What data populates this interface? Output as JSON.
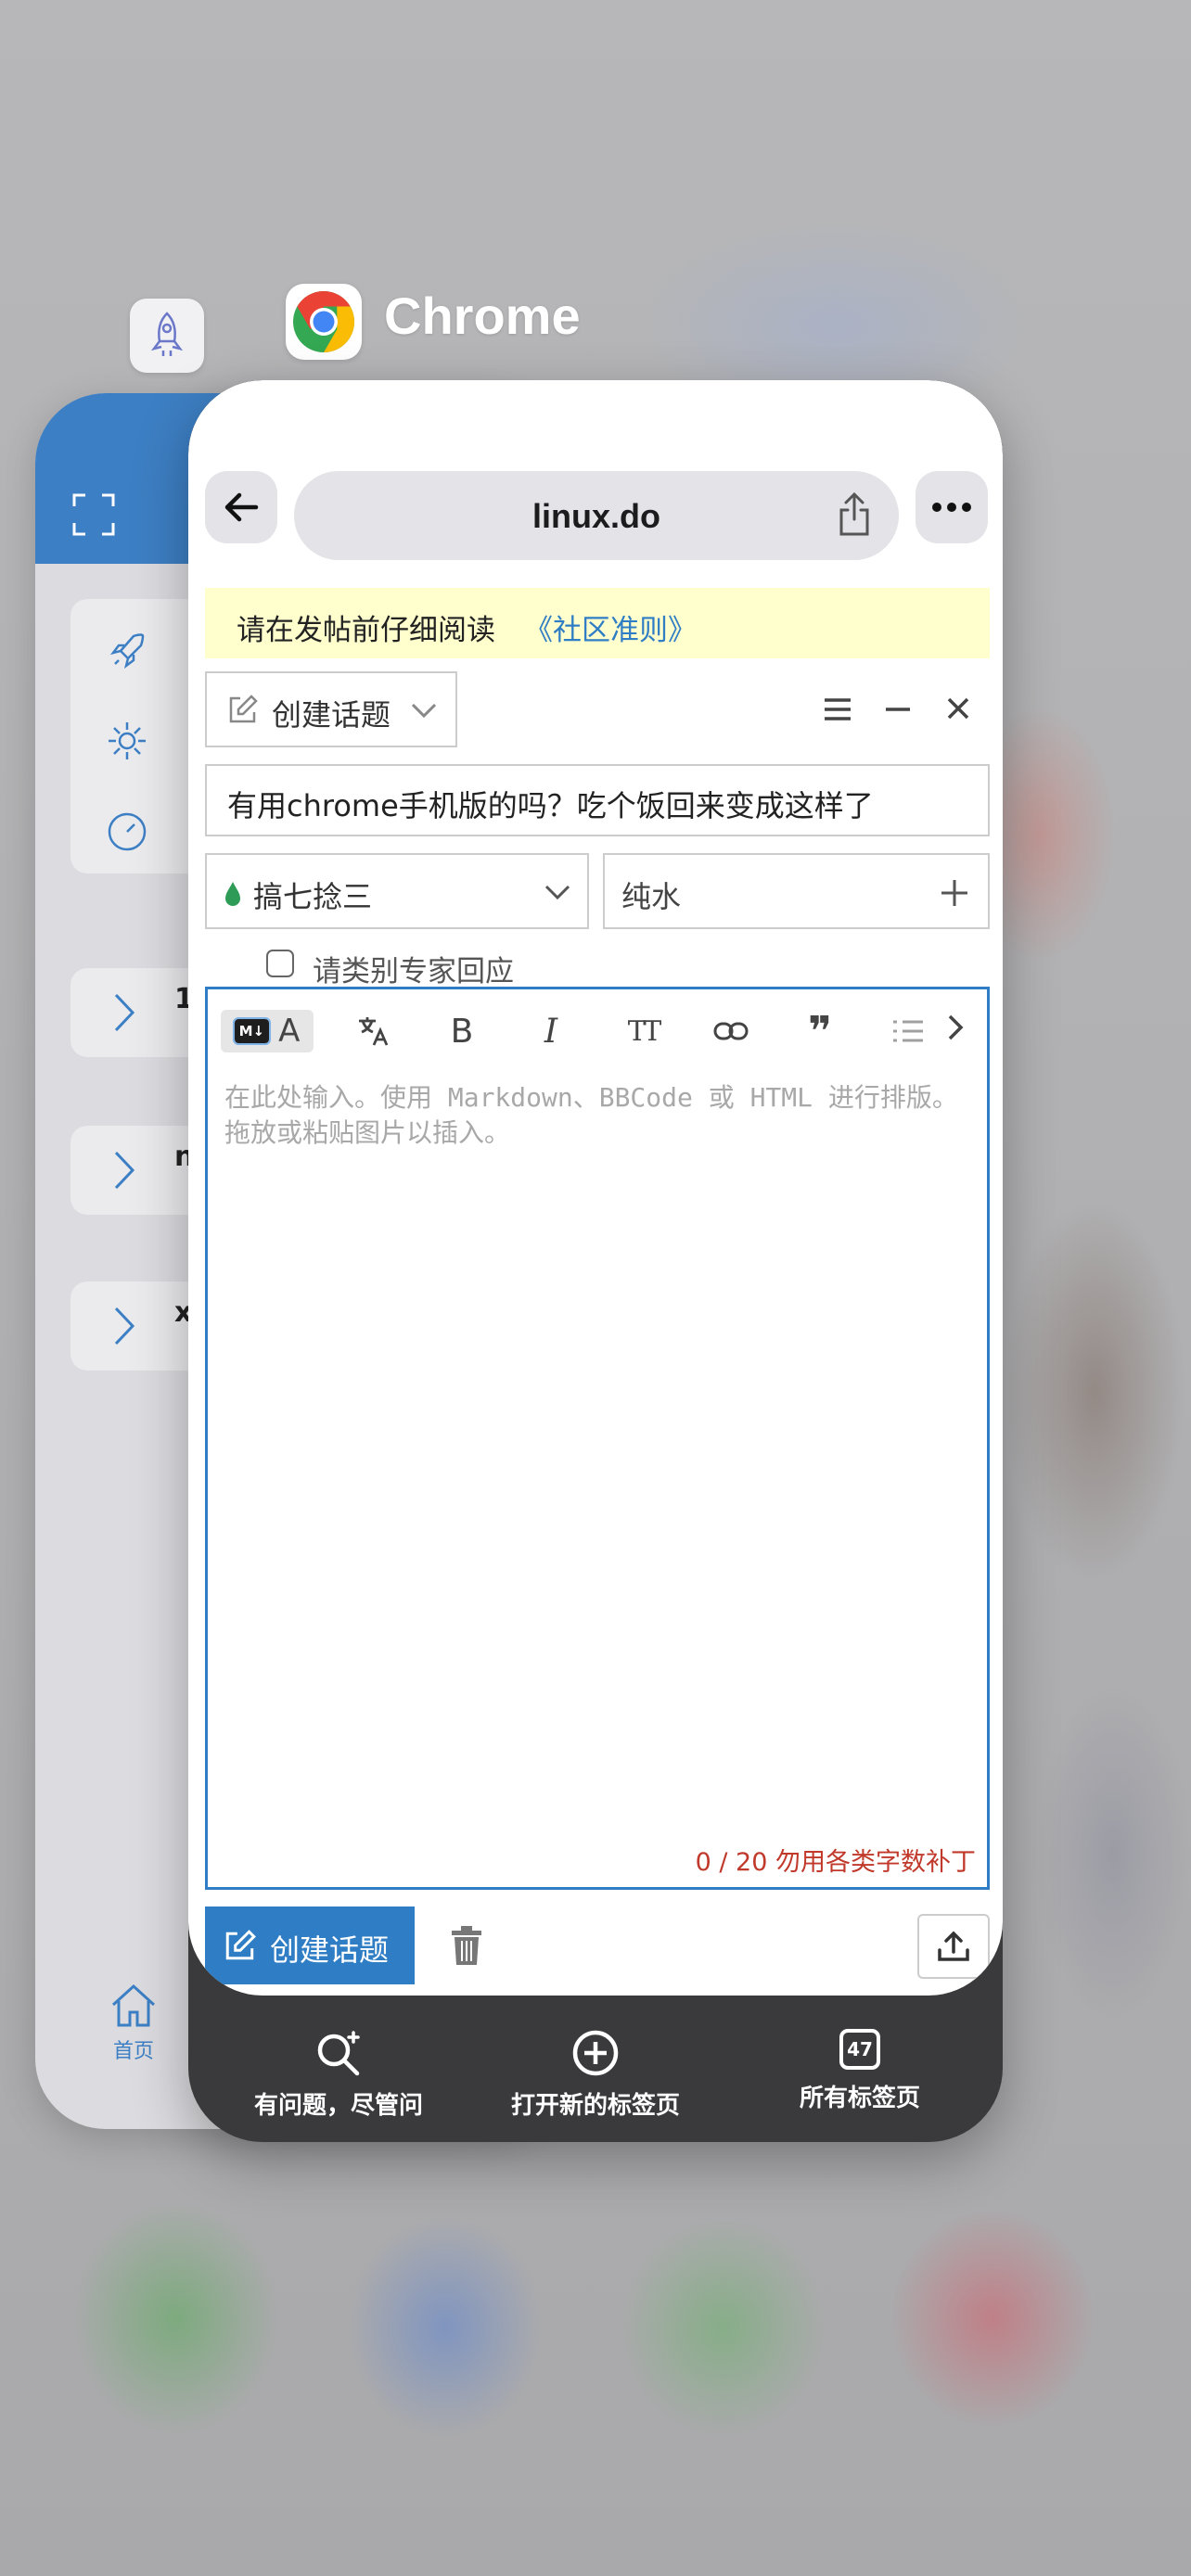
{
  "back_app": {
    "rows": [
      "1",
      "n",
      "x"
    ],
    "tab_home": "首页"
  },
  "app_switcher": {
    "app_name": "Chrome"
  },
  "browser": {
    "url": "linux.do",
    "bottom_bar": {
      "search": "有问题，尽管问",
      "new_tab": "打开新的标签页",
      "all_tabs": "所有标签页",
      "tab_count": "47"
    }
  },
  "composer": {
    "notice_prefix": "请在发帖前仔细阅读",
    "notice_link": "《社区准则》",
    "action_select": "创建话题",
    "title_value": "有用chrome手机版的吗？吃个饭回来变成这样了",
    "category": "搞七捻三",
    "tag": "纯水",
    "expert_checkbox_label": "请类别专家回应",
    "editor_placeholder": "在此处输入。使用 Markdown、BBCode 或 HTML 进行排版。拖放或粘贴图片以插入。",
    "counter": "0 / 20 勿用各类字数补丁",
    "submit_label": "创建话题",
    "md_badge": "M↓",
    "toolbar_glyphs": {
      "text": "A",
      "bold": "B",
      "italic": "I",
      "heading": "TT",
      "quote": "❞"
    }
  },
  "colors": {
    "accent": "#2f7dc4",
    "notice_bg": "#ffffce",
    "warning": "#c0392b",
    "category_dot": "#2e9c57"
  }
}
